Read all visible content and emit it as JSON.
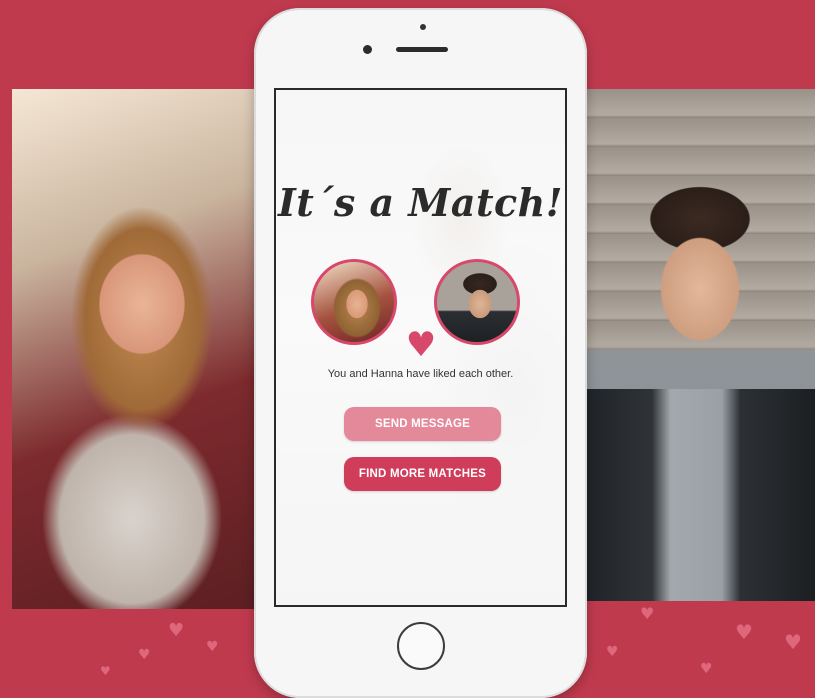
{
  "match_screen": {
    "title": "It´s a Match!",
    "liked_message": "You and Hanna have liked each other.",
    "send_message_label": "SEND MESSAGE",
    "find_more_label": "FIND MORE MATCHES",
    "heart_icon": "♥"
  },
  "colors": {
    "background": "#c03a4e",
    "accent": "#cf3d5b",
    "accent_light": "#e3899a",
    "avatar_ring": "#d7486a"
  },
  "background_hearts": [
    "♥",
    "♥",
    "♥",
    "♥",
    "♥",
    "♥",
    "♥",
    "♥",
    "♥"
  ]
}
